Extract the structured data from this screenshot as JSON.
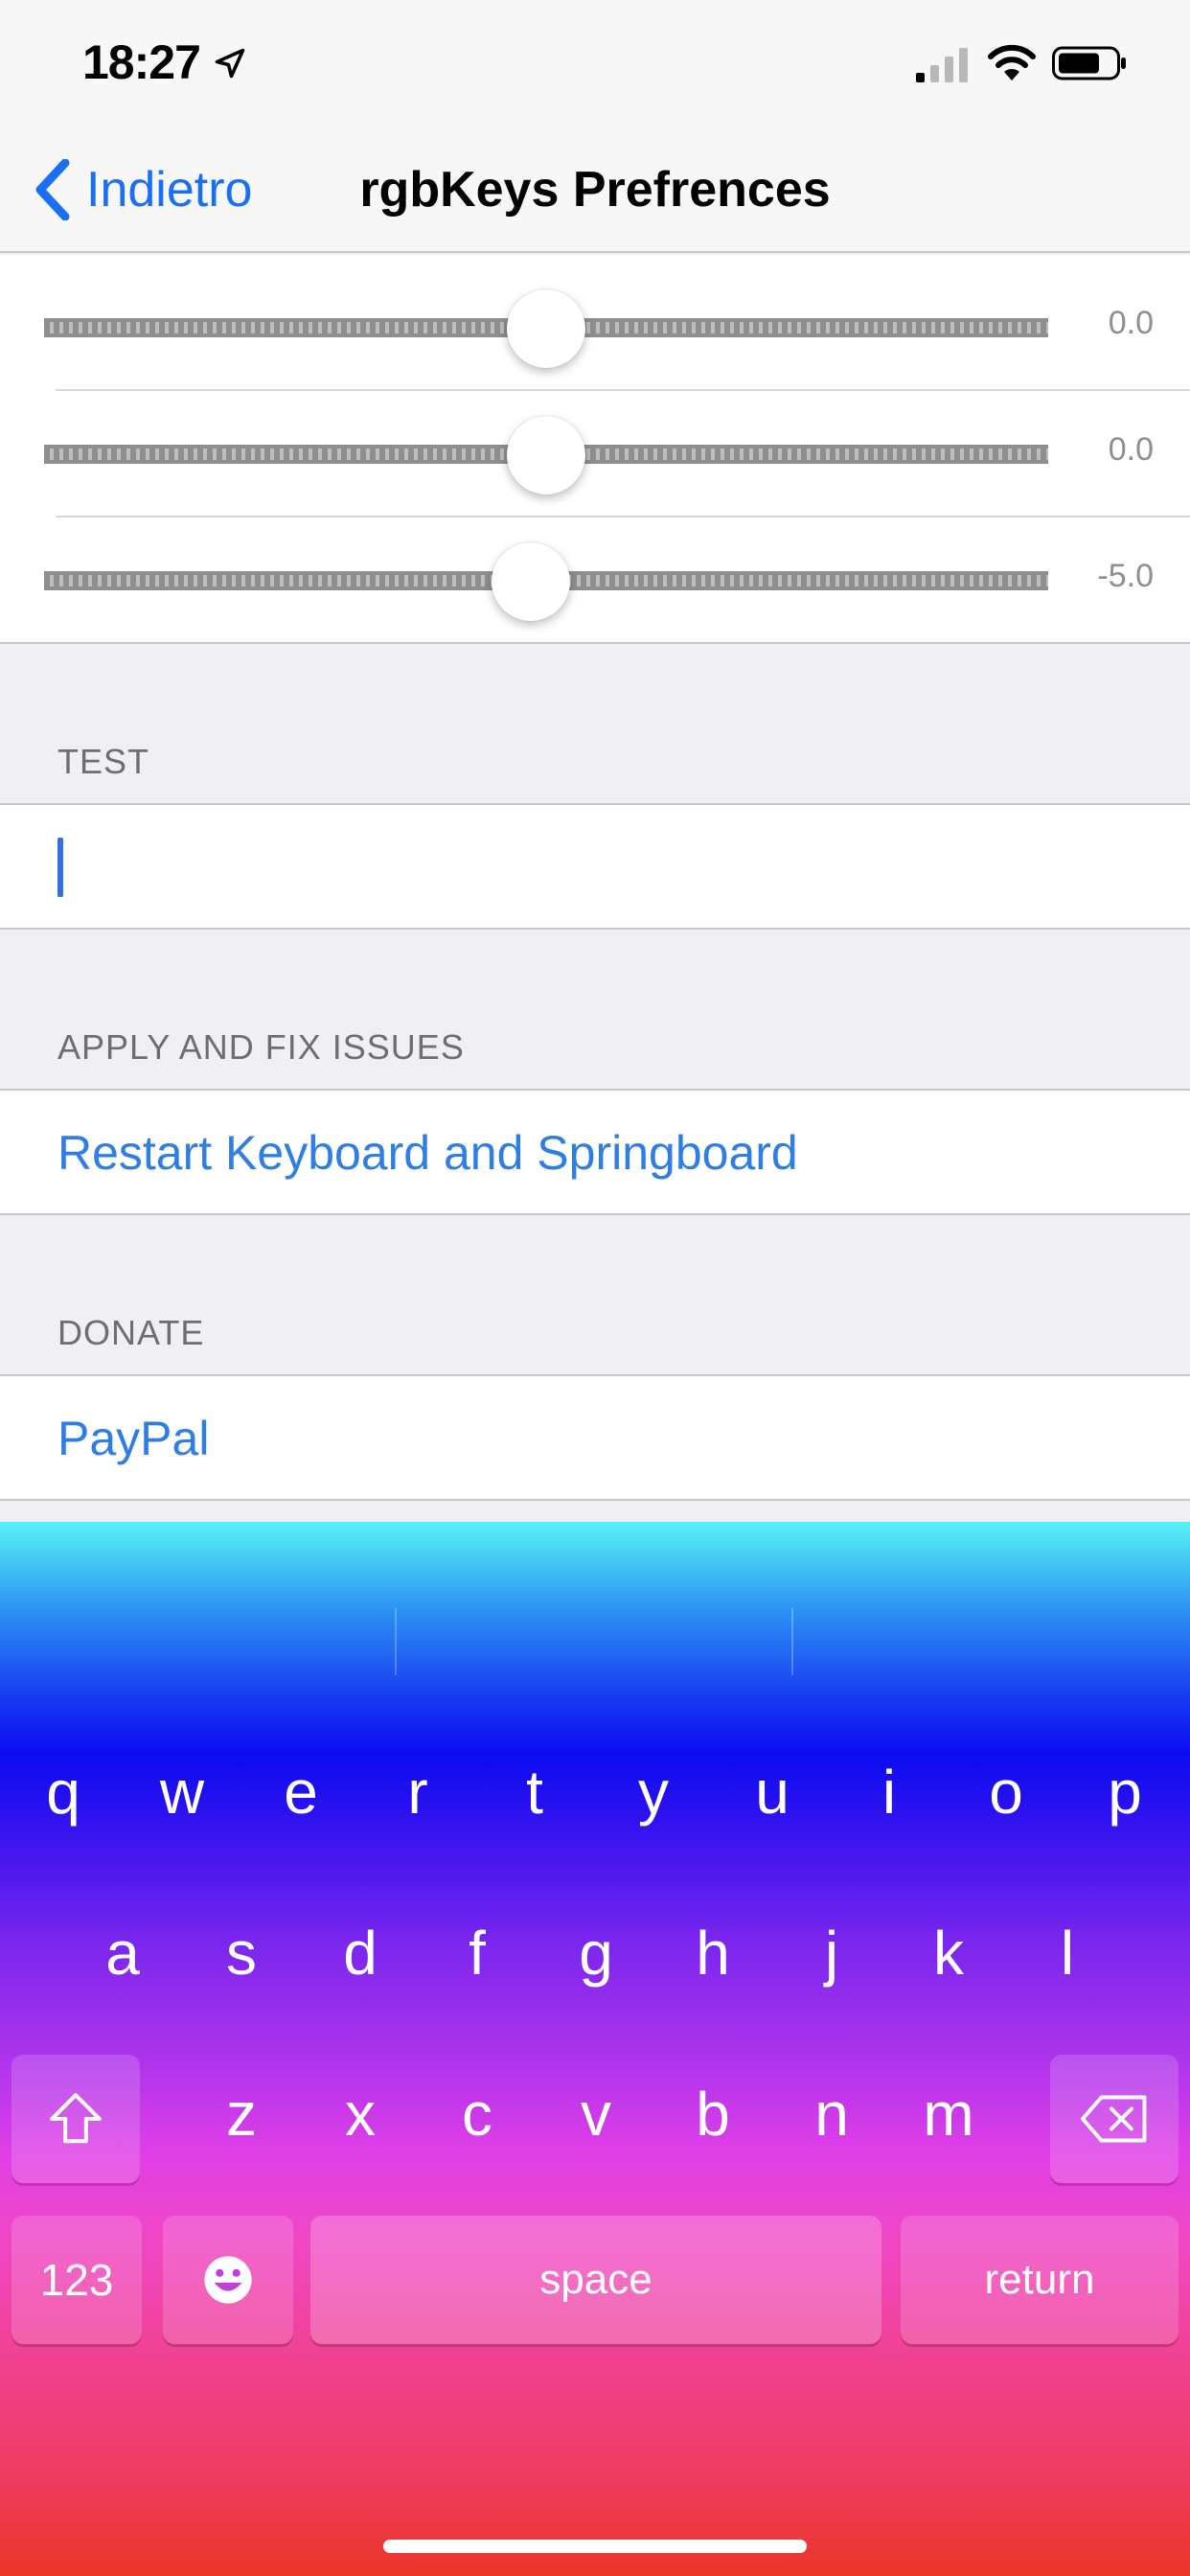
{
  "status_bar": {
    "time": "18:27"
  },
  "nav": {
    "back_label": "Indietro",
    "title": "rgbKeys Prefrences"
  },
  "sliders": [
    {
      "value_label": "0.0",
      "level": 0.5
    },
    {
      "value_label": "0.0",
      "level": 0.5
    },
    {
      "value_label": "-5.0",
      "level": 0.485
    }
  ],
  "test_section": {
    "header": "TEST",
    "input_value": ""
  },
  "apply_section": {
    "header": "APPLY AND FIX ISSUES",
    "action": "Restart Keyboard and Springboard"
  },
  "donate_section": {
    "header": "DONATE",
    "action": "PayPal"
  },
  "keyboard": {
    "row1": [
      "q",
      "w",
      "e",
      "r",
      "t",
      "y",
      "u",
      "i",
      "o",
      "p"
    ],
    "row2": [
      "a",
      "s",
      "d",
      "f",
      "g",
      "h",
      "j",
      "k",
      "l"
    ],
    "row3": [
      "z",
      "x",
      "c",
      "v",
      "b",
      "n",
      "m"
    ],
    "numbers_key": "123",
    "space_key": "space",
    "return_key": "return"
  },
  "colors": {
    "accent": "#2f7ee6",
    "background": "#efeff4"
  }
}
